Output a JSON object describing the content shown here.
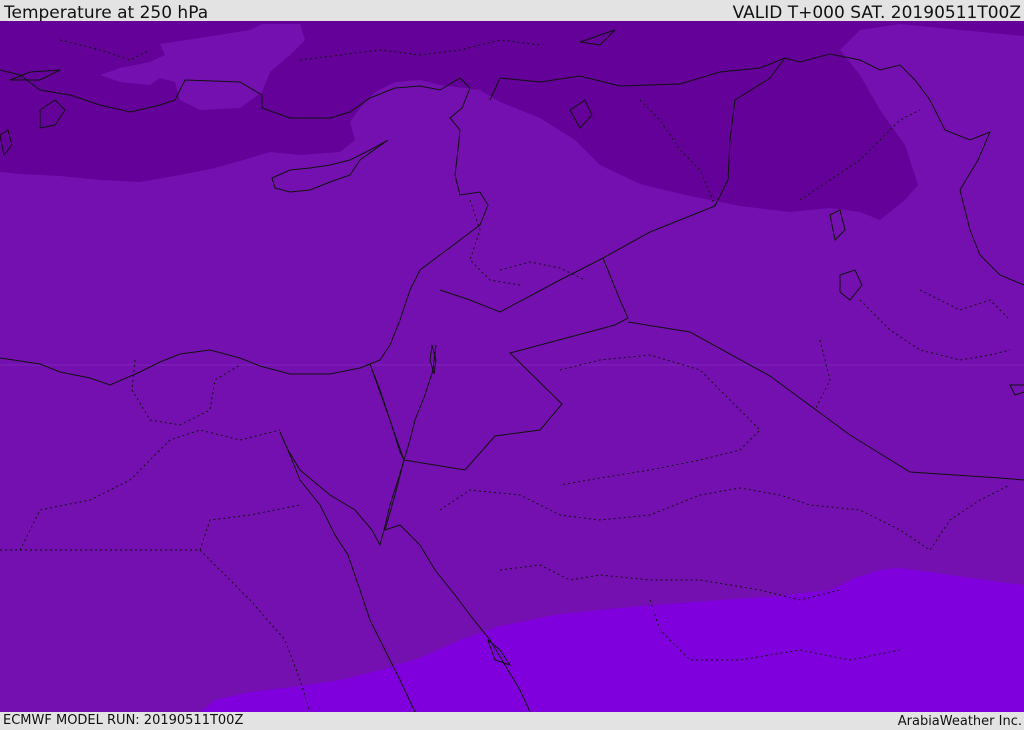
{
  "header": {
    "title": "Temperature at 250 hPa",
    "valid": "VALID T+000 SAT. 20190511T00Z"
  },
  "footer": {
    "model_run": "ECMWF MODEL RUN: 20190511T00Z",
    "credit": "ArabiaWeather Inc."
  },
  "colors": {
    "dark_band": "#640199",
    "mid_band": "#7510b0",
    "light_band": "#7f00dd",
    "border": "#111111",
    "bar_background": "#e3e3e3"
  }
}
